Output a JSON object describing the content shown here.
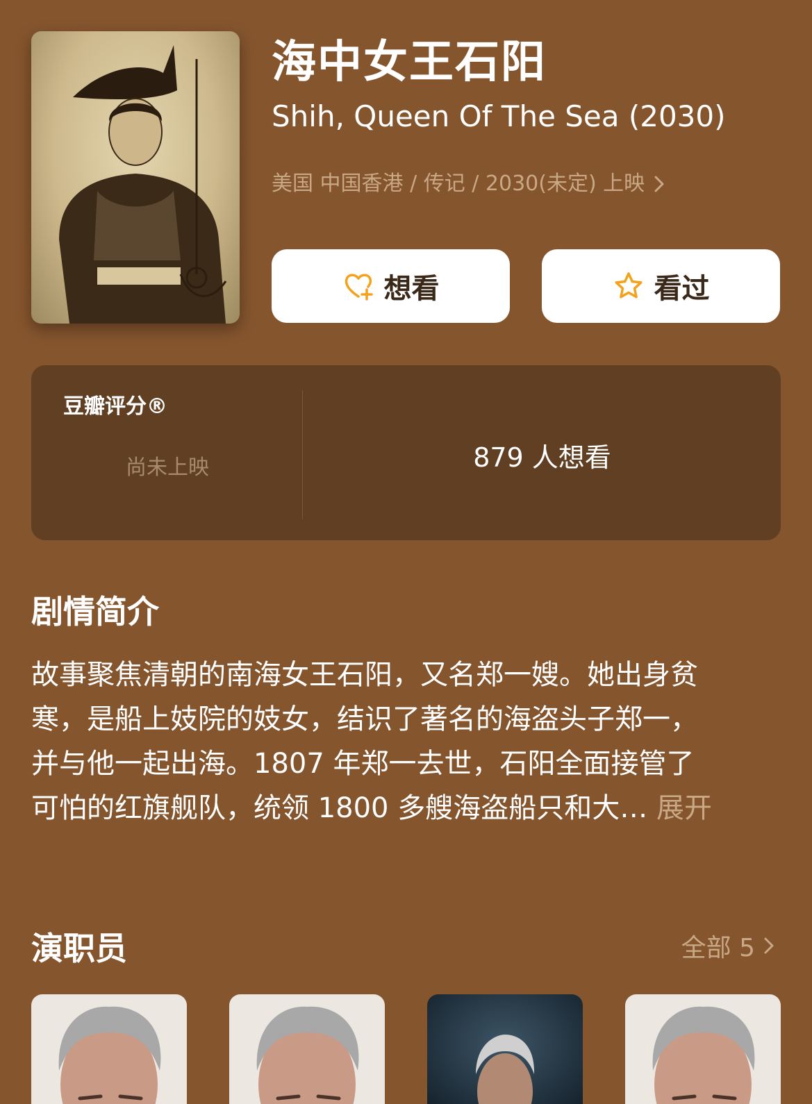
{
  "movie": {
    "title_zh": "海中女王石阳",
    "title_en": "Shih, Queen Of The Sea (2030)",
    "meta": "美国 中国香港 / 传记 / 2030(未定) 上映"
  },
  "actions": {
    "want_label": "想看",
    "seen_label": "看过"
  },
  "rating": {
    "brand": "豆瓣评分®",
    "status": "尚未上映",
    "wish_count": "879 人想看"
  },
  "synopsis": {
    "title": "剧情简介",
    "lines": [
      "故事聚焦清朝的南海女王石阳，又名郑一嫂。她出身贫",
      "寒，是船上妓院的妓女，结识了著名的海盗头子郑一，",
      "并与他一起出海。1807 年郑一去世，石阳全面接管了",
      "可怕的红旗舰队，统领 1800 多艘海盗船只和大…"
    ],
    "expand_label": "展开"
  },
  "cast": {
    "title": "演职员",
    "all_label": "全部 5"
  },
  "colors": {
    "background": "#85552e",
    "panel": "#603f23",
    "muted_text": "#c9a886",
    "icon_accent": "#f3a21b"
  },
  "icons": {
    "want": "heart-plus-icon",
    "seen": "star-icon",
    "chevron": "chevron-right-icon"
  }
}
